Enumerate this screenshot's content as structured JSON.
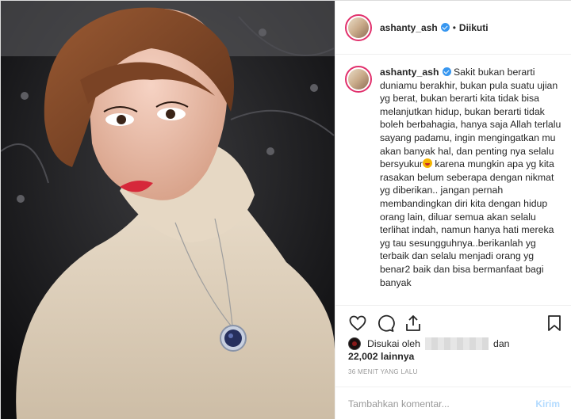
{
  "header": {
    "username": "ashanty_ash",
    "separator": "•",
    "follow_status": "Diikuti"
  },
  "caption": {
    "username": "ashanty_ash",
    "text_part1": "Sakit bukan berarti duniamu berakhir, bukan pula suatu ujian yg berat, bukan berarti kita tidak bisa melanjutkan hidup, bukan berarti tidak boleh berbahagia, hanya saja Allah terlalu sayang padamu, ingin mengingatkan mu akan banyak hal, dan penting nya selalu bersyukur",
    "text_part2": "karena mungkin apa yg kita rasakan belum seberapa dengan nikmat yg diberikan.. jangan pernah membandingkan diri kita dengan hidup orang lain, diluar semua akan selalu terlihat indah, namun hanya hati mereka yg tau sesungguhnya..berikanlah yg terbaik dan selalu menjadi orang yg benar2 baik dan bisa bermanfaat bagi banyak"
  },
  "likes": {
    "prefix": "Disukai oleh",
    "conjunction": "dan",
    "count_text": "22,002 lainnya"
  },
  "timestamp": "36 MENIT YANG LALU",
  "comment": {
    "placeholder": "Tambahkan komentar...",
    "post_label": "Kirim"
  },
  "colors": {
    "verified": "#3897f0",
    "post_button_disabled": "#b3dbff",
    "avatar_ring": "#e1306c"
  },
  "icons": [
    "heart-icon",
    "comment-icon",
    "share-icon",
    "bookmark-icon",
    "verified-icon"
  ]
}
